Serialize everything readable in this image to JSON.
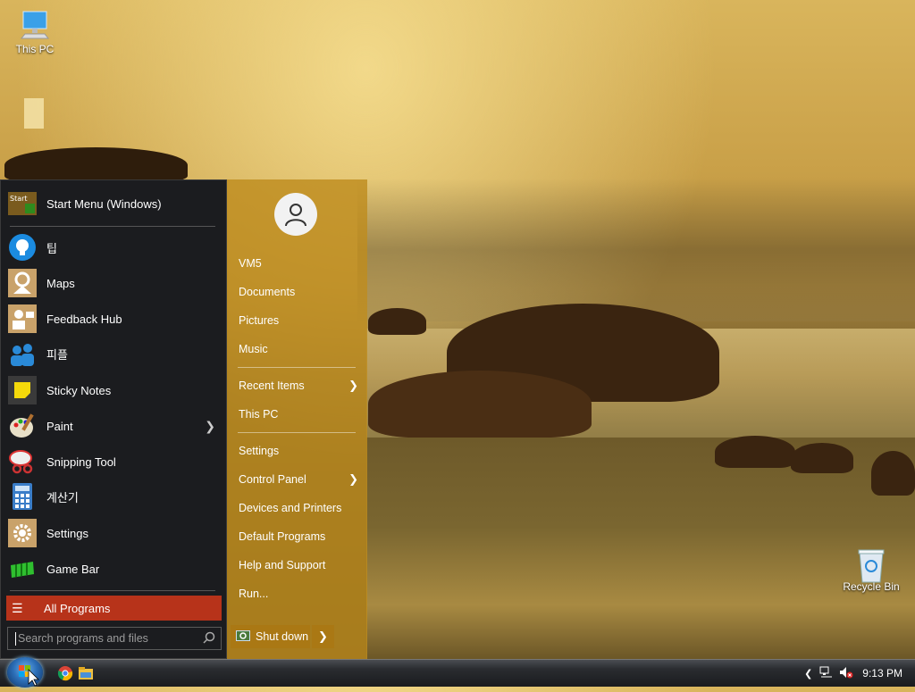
{
  "desktop": {
    "icons": [
      {
        "label": "This PC",
        "name": "this-pc"
      },
      {
        "label": "Recycle Bin",
        "name": "recycle-bin"
      }
    ]
  },
  "start_menu": {
    "pinned": [
      {
        "label": "Start Menu (Windows)",
        "icon": "start-menu-icon"
      },
      {
        "label": "팁",
        "icon": "tips-icon"
      },
      {
        "label": "Maps",
        "icon": "maps-icon"
      },
      {
        "label": "Feedback Hub",
        "icon": "feedback-hub-icon"
      },
      {
        "label": "피플",
        "icon": "people-icon"
      },
      {
        "label": "Sticky Notes",
        "icon": "sticky-notes-icon"
      },
      {
        "label": "Paint",
        "icon": "paint-icon"
      },
      {
        "label": "Snipping Tool",
        "icon": "snipping-tool-icon"
      },
      {
        "label": "계산기",
        "icon": "calculator-icon"
      },
      {
        "label": "Settings",
        "icon": "settings-icon"
      },
      {
        "label": "Game Bar",
        "icon": "game-bar-icon"
      }
    ],
    "all_programs": "All Programs",
    "search_placeholder": "Search programs and files",
    "right": {
      "items": [
        {
          "label": "VM5"
        },
        {
          "label": "Documents"
        },
        {
          "label": "Pictures"
        },
        {
          "label": "Music"
        },
        {
          "label": "Recent Items"
        },
        {
          "label": "This PC"
        },
        {
          "label": "Settings"
        },
        {
          "label": "Control Panel"
        },
        {
          "label": "Devices and Printers"
        },
        {
          "label": "Default Programs"
        },
        {
          "label": "Help and Support"
        },
        {
          "label": "Run..."
        }
      ],
      "shutdown": "Shut down"
    }
  },
  "taskbar": {
    "clock": "9:13 PM",
    "pinned": [
      "chrome-icon",
      "file-explorer-icon"
    ]
  },
  "colors": {
    "accent_right": "#be8c1e",
    "all_programs_bg": "#b7331a",
    "left_pane_bg": "#1b1c1f"
  }
}
